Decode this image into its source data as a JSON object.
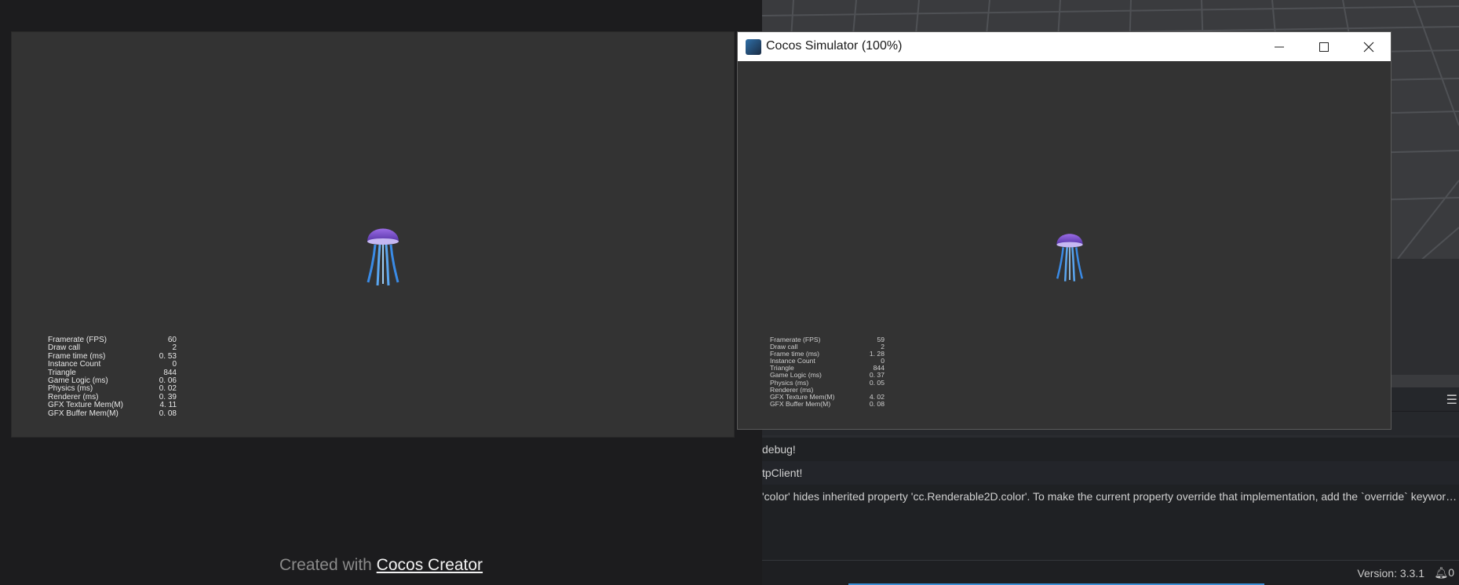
{
  "preview": {
    "stats": [
      {
        "label": "Framerate (FPS)",
        "value": "60"
      },
      {
        "label": "Draw call",
        "value": "2"
      },
      {
        "label": "Frame time (ms)",
        "value": "0. 53"
      },
      {
        "label": "Instance Count",
        "value": "0"
      },
      {
        "label": "Triangle",
        "value": "844"
      },
      {
        "label": "Game Logic (ms)",
        "value": "0. 06"
      },
      {
        "label": "Physics (ms)",
        "value": "0. 02"
      },
      {
        "label": "Renderer (ms)",
        "value": "0. 39"
      },
      {
        "label": "GFX Texture Mem(M)",
        "value": "4. 11"
      },
      {
        "label": "GFX Buffer Mem(M)",
        "value": "0. 08"
      }
    ],
    "footer_prefix": "Created with ",
    "footer_link": "Cocos Creator"
  },
  "simulator": {
    "title": "Cocos Simulator (100%)",
    "stats": [
      {
        "label": "Framerate (FPS)",
        "value": "59"
      },
      {
        "label": "Draw call",
        "value": "2"
      },
      {
        "label": "Frame time (ms)",
        "value": "1. 28"
      },
      {
        "label": "Instance Count",
        "value": "0"
      },
      {
        "label": "Triangle",
        "value": "844"
      },
      {
        "label": "Game Logic (ms)",
        "value": "0. 37"
      },
      {
        "label": "Physics (ms)",
        "value": "0. 05"
      },
      {
        "label": "Renderer (ms)",
        "value": ""
      },
      {
        "label": "GFX Texture Mem(M)",
        "value": "4. 02"
      },
      {
        "label": "GFX Buffer Mem(M)",
        "value": "0. 08"
      }
    ]
  },
  "editor": {
    "console": [
      "debug!",
      "tpClient!",
      "'color' hides inherited property 'cc.Renderable2D.color'. To make the current property override that implementation, add the `override` keyword to its declaration."
    ],
    "version": "Version: 3.3.1",
    "notification_count": "0"
  },
  "colors": {
    "jelly_top": "#8a5ad8",
    "jelly_bottom": "#4a2a9a",
    "tentacle": "#3a8be6",
    "link_blue": "#3b8fd4"
  }
}
